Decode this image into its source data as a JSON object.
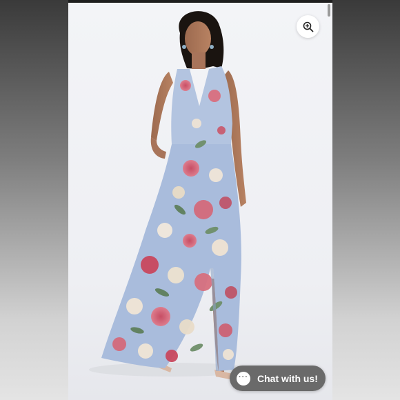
{
  "viewer": {
    "image_alt": "Model wearing a sleeveless V-neck floral maxi dress",
    "zoom_icon": "zoom-in-icon"
  },
  "chat_widget": {
    "label": "Chat with us!",
    "icon": "chat-bubble-icon"
  },
  "colors": {
    "dress_base": "#a9bcdc",
    "chat_button": "#6a6a6a",
    "backdrop": "#f1f2f5"
  }
}
